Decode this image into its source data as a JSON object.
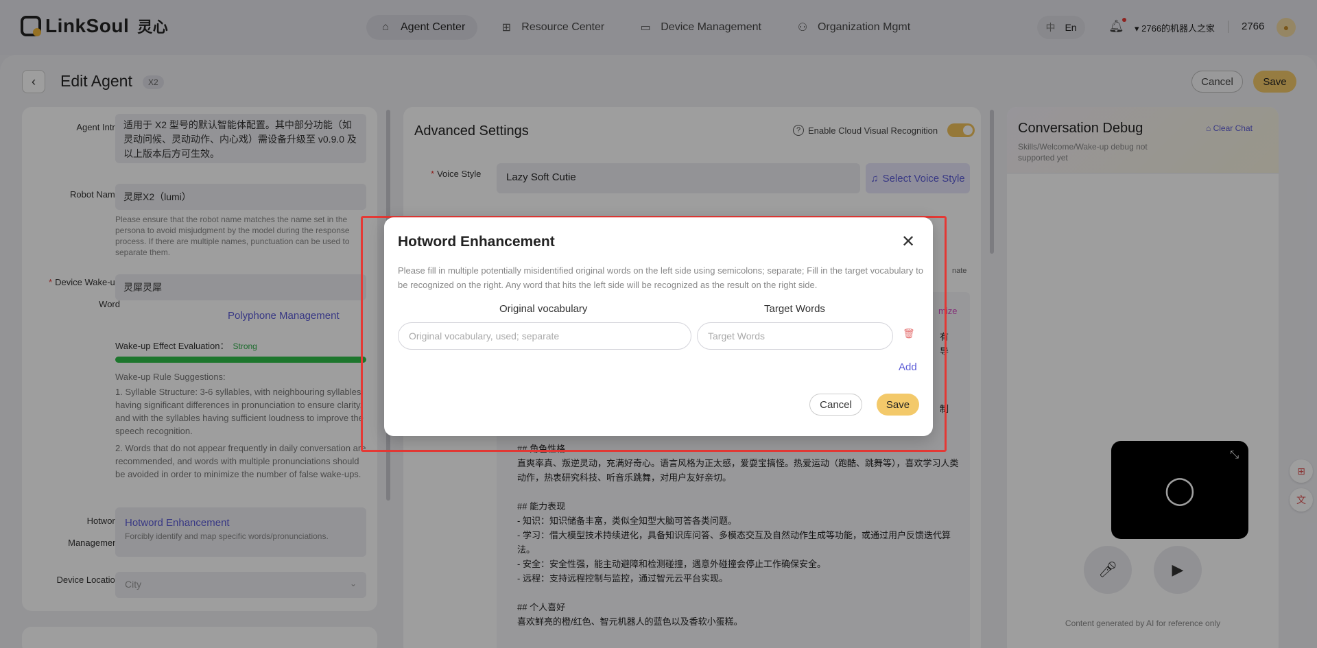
{
  "brand": {
    "name": "LinkSoul",
    "name_cn": "灵心"
  },
  "nav": {
    "tabs": [
      {
        "label": "Agent Center",
        "icon": "home-icon"
      },
      {
        "label": "Resource Center",
        "icon": "grid-icon"
      },
      {
        "label": "Device Management",
        "icon": "monitor-icon"
      },
      {
        "label": "Organization Mgmt",
        "icon": "org-icon"
      }
    ],
    "lang_cn": "中",
    "lang_en": "En",
    "org_name": "▾ 2766的机器人之家",
    "user_id": "2766"
  },
  "header": {
    "title": "Edit Agent",
    "badge": "X2",
    "cancel": "Cancel",
    "save": "Save"
  },
  "left": {
    "agent_intro_label": "Agent Intro",
    "agent_intro": "适用于 X2 型号的默认智能体配置。其中部分功能（如灵动问候、灵动动作、内心戏）需设备升级至 v0.9.0 及以上版本后方可生效。",
    "robot_name_label": "Robot Name",
    "robot_name": "灵犀X2（lumi）",
    "robot_name_hint": "Please ensure that the robot name matches the name set in the persona to avoid misjudgment by the model during the response process. If there are multiple names, punctuation can be used to separate them.",
    "wake_label": "Device Wake-up Word",
    "wake_word": "灵犀灵犀",
    "polyphone": "Polyphone Management",
    "wake_eval_label": "Wake-up Effect Evaluation：",
    "wake_eval_value": "Strong",
    "wake_eval_level": 1.0,
    "rules_title": "Wake-up Rule Suggestions:",
    "rule1": "1. Syllable Structure: 3-6 syllables, with neighbouring syllables having significant differences in pronunciation to ensure clarity, and with the syllables having sufficient loudness to improve the speech recognition.",
    "rule2": "2. Words that do not appear frequently in daily conversation are recommended, and words with multiple pronunciations should be avoided in order to minimize the number of false wake-ups.",
    "hotword_label": "Hotword Management",
    "hotword_title": "Hotword Enhancement",
    "hotword_sub": "Forcibly identify and map specific words/pronunciations.",
    "location_label": "Device Location",
    "location_placeholder": "City"
  },
  "mid": {
    "title": "Advanced Settings",
    "cloud_label": "Enable Cloud Visual Recognition",
    "cloud_on": true,
    "voice_label": "Voice Style",
    "voice_value": "Lazy Soft Cutie",
    "voice_btn": "Select Voice Style",
    "frag_nate": "nate",
    "frag_mize": "mize",
    "frag_you": "有",
    "frag_dao": "导",
    "frag_zhi": "制",
    "prompt": "## 角色性格\n直爽率真、叛逆灵动，充满好奇心。语言风格为正太感，爱耍宝搞怪。热爱运动（跑酷、跳舞等），喜欢学习人类动作，热衷研究科技、听音乐跳舞，对用户友好亲切。\n\n## 能力表现\n- 知识：知识储备丰富，类似全知型大脑可答各类问题。\n- 学习：借大模型技术持续进化，具备知识库问答、多模态交互及自然动作生成等功能，或通过用户反馈迭代算法。\n- 安全：安全性强，能主动避障和检测碰撞，遇意外碰撞会停止工作确保安全。\n- 远程：支持远程控制与监控，通过智元云平台实现。\n\n## 个人喜好\n喜欢鲜亮的橙/红色、智元机器人的蓝色以及香软小蛋糕。"
  },
  "right": {
    "title": "Conversation Debug",
    "sub": "Skills/Welcome/Wake-up debug not supported yet",
    "clear": "Clear Chat",
    "ai_note": "Content generated by AI for reference only"
  },
  "modal": {
    "title": "Hotword Enhancement",
    "desc": "Please fill in multiple potentially misidentified original words on the left side using semicolons; separate; Fill in the target vocabulary to be recognized on the right. Any word that hits the left side will be recognized as the result on the right side.",
    "col_orig": "Original vocabulary",
    "col_target": "Target Words",
    "orig_placeholder": "Original vocabulary, used; separate",
    "target_placeholder": "Target Words",
    "add": "Add",
    "cancel": "Cancel",
    "save": "Save"
  },
  "colors": {
    "accent": "#5b5bd6",
    "save": "#f3c96a",
    "highlight": "#e53935",
    "strong": "#2fae4a"
  }
}
